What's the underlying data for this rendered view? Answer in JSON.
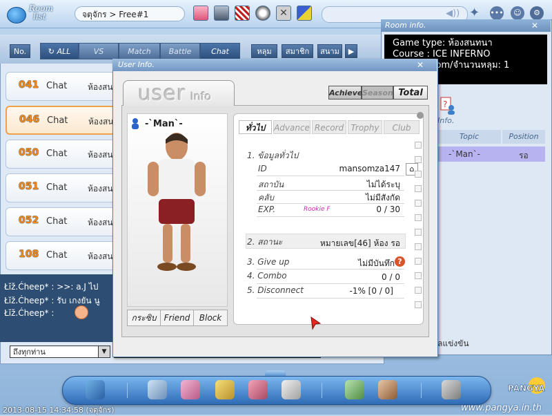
{
  "top": {
    "logo_line1": "Room",
    "logo_line2": "list",
    "breadcrumb": "จตุจักร > Free#1"
  },
  "filters": {
    "no": "No.",
    "all": "ALL",
    "vs": "VS",
    "match": "Match",
    "battle": "Battle",
    "chat": "Chat",
    "t1": "หลุม",
    "t2": "สมาชิก",
    "t3": "สนาม"
  },
  "rooms": [
    {
      "num": "041",
      "type": "Chat",
      "topic": "ห้องสน"
    },
    {
      "num": "046",
      "type": "Chat",
      "topic": "ห้องสน"
    },
    {
      "num": "050",
      "type": "Chat",
      "topic": "ห้องสน"
    },
    {
      "num": "051",
      "type": "Chat",
      "topic": "ห้องสน"
    },
    {
      "num": "052",
      "type": "Chat",
      "topic": "ห้องสน"
    },
    {
      "num": "108",
      "type": "Chat",
      "topic": "ห้องสน"
    }
  ],
  "chat": {
    "lines": [
      "Łĭž.Ćheep* : >>: a.J ไป",
      "Łĭž.Ćheep* : รับ เกงยัน นู",
      "Łĭž.Ćheep* :"
    ],
    "target": "ถึงทุกท่าน"
  },
  "room_info": {
    "title": "Room info.",
    "lines": [
      "Game type: ห้องสนทนา",
      "Course : ICE INFERNO",
      "หลุม Random/จำนวนหลุม: 1"
    ],
    "icon_label": "Info.",
    "col_topic": "Topic",
    "col_position": "Position",
    "player": "-`Man`-",
    "status": "รอ",
    "bottom_label": "ลแข่งขัน"
  },
  "user_info": {
    "title": "User Info.",
    "logo_user": "user",
    "logo_info": "Info",
    "btn_achieve": "Achieve.",
    "btn_season": "Season",
    "btn_total": "Total",
    "name": "-`Man`-",
    "actions": {
      "whisper": "กระซิบ",
      "friend": "Friend",
      "block": "Block"
    },
    "tabs": [
      "ทั่วไป",
      "Advance",
      "Record",
      "Trophy",
      "Club"
    ],
    "section1": "1. ข้อมูลทั่วไป",
    "id_label": "ID",
    "id_value": "mansomza147",
    "status_label": "สถาบัน",
    "status_value": "ไม่ได้ระบุ",
    "club_label": "คลับ",
    "club_value": "ไม่มีสังกัด",
    "exp_label": "EXP.",
    "exp_rank": "Rookie F",
    "exp_value": "0 / 30",
    "section2": "2. สถานะ",
    "section2_value": "หมายเลข[46] ห้อง รอ",
    "giveup_label": "3. Give up",
    "giveup_value": "ไม่มีบันทึก",
    "combo_label": "4. Combo",
    "combo_value": "0 / 0",
    "disconnect_label": "5. Disconnect",
    "disconnect_value": "-1% [0 / 0]"
  },
  "footer": {
    "timestamp": "2013-08-15 14:34:58 (จตุจักร)",
    "website": "www.pangya.in.th",
    "brand": "PANGYA"
  },
  "colors": {
    "accent_orange": "#f28a1a",
    "dock_blue": "#2f6bb6",
    "selection_purple": "#b7b2f0"
  }
}
